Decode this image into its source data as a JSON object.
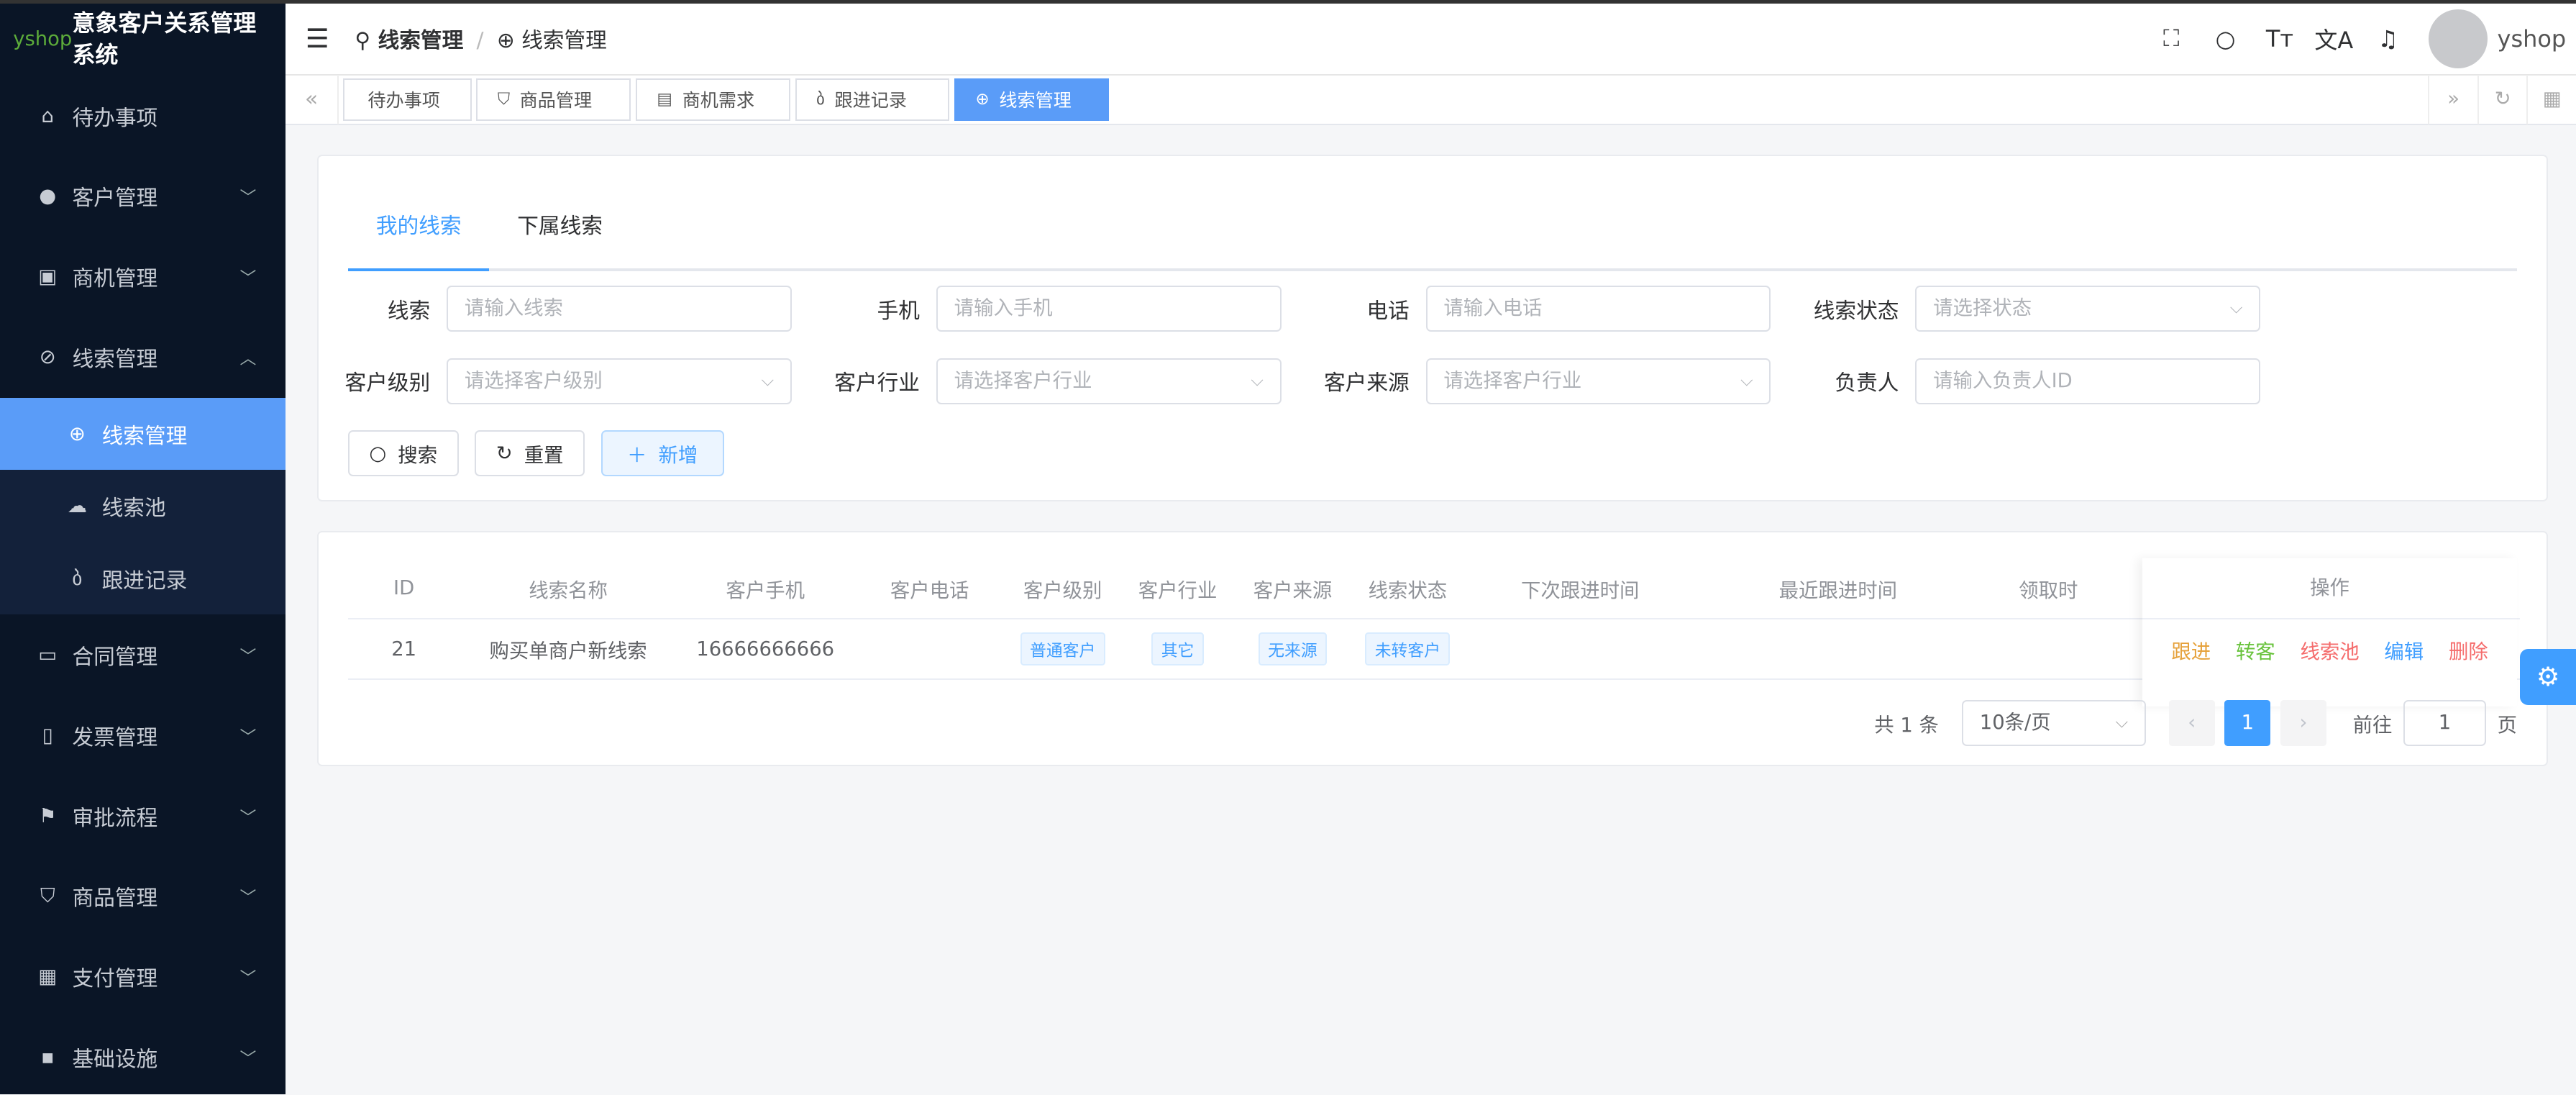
{
  "app": {
    "logo_text": "yshop",
    "title": "意象客户关系管理系统"
  },
  "sidebar": {
    "items": [
      {
        "label": "待办事项",
        "icon": "home-icon",
        "glyph": "⌂"
      },
      {
        "label": "客户管理",
        "icon": "user-icon",
        "glyph": "●"
      },
      {
        "label": "商机管理",
        "icon": "opportunity-icon",
        "glyph": "▣"
      },
      {
        "label": "线索管理",
        "icon": "link-icon",
        "glyph": "⊘"
      },
      {
        "label": "合同管理",
        "icon": "folder-icon",
        "glyph": "▭"
      },
      {
        "label": "发票管理",
        "icon": "bookmark-icon",
        "glyph": "▯"
      },
      {
        "label": "审批流程",
        "icon": "flag-icon",
        "glyph": "⚑"
      },
      {
        "label": "商品管理",
        "icon": "cart-icon",
        "glyph": "⛉"
      },
      {
        "label": "支付管理",
        "icon": "calculator-icon",
        "glyph": "▦"
      },
      {
        "label": "基础设施",
        "icon": "grid-icon",
        "glyph": "▪"
      }
    ],
    "sub_items": [
      {
        "label": "线索管理",
        "glyph": "⊕"
      },
      {
        "label": "线索池",
        "glyph": "☁"
      },
      {
        "label": "跟进记录",
        "glyph": "ბ"
      }
    ]
  },
  "header": {
    "breadcrumb": [
      "线索管理",
      "线索管理"
    ],
    "username": "yshop"
  },
  "tabs": [
    {
      "label": "待办事项",
      "glyph": ""
    },
    {
      "label": "商品管理",
      "glyph": "⛉"
    },
    {
      "label": "商机需求",
      "glyph": "▤"
    },
    {
      "label": "跟进记录",
      "glyph": "ბ"
    },
    {
      "label": "线索管理",
      "glyph": "⊕"
    }
  ],
  "search": {
    "tabs": [
      "我的线索",
      "下属线索"
    ],
    "fields": [
      {
        "label": "线索",
        "placeholder": "请输入线索"
      },
      {
        "label": "手机",
        "placeholder": "请输入手机"
      },
      {
        "label": "电话",
        "placeholder": "请输入电话"
      },
      {
        "label": "线索状态",
        "placeholder": "请选择状态"
      },
      {
        "label": "客户级别",
        "placeholder": "请选择客户级别"
      },
      {
        "label": "客户行业",
        "placeholder": "请选择客户行业"
      },
      {
        "label": "客户来源",
        "placeholder": "请选择客户行业"
      },
      {
        "label": "负责人",
        "placeholder": "请输入负责人ID"
      }
    ],
    "buttons": {
      "search": "搜索",
      "reset": "重置",
      "add": "新增"
    }
  },
  "table": {
    "columns": [
      "ID",
      "线索名称",
      "客户手机",
      "客户电话",
      "客户级别",
      "客户行业",
      "客户来源",
      "线索状态",
      "下次跟进时间",
      "最近跟进时间",
      "领取时"
    ],
    "ops_header": "操作",
    "rows": [
      {
        "id": "21",
        "name": "购买单商户新线索",
        "mobile": "16666666666",
        "phone": "",
        "level": "普通客户",
        "industry": "其它",
        "source": "无来源",
        "status": "未转客户",
        "next": "",
        "last": "",
        "claim": ""
      }
    ],
    "actions": [
      {
        "label": "跟进",
        "color": "#e6a23c"
      },
      {
        "label": "转客",
        "color": "#67c23a"
      },
      {
        "label": "线索池",
        "color": "#f56c6c"
      },
      {
        "label": "编辑",
        "color": "#409eff"
      },
      {
        "label": "删除",
        "color": "#f56c6c"
      }
    ]
  },
  "pagination": {
    "total": "共 1 条",
    "page_size": "10条/页",
    "current": "1",
    "goto_label": "前往",
    "goto_value": "1",
    "page_suffix": "页"
  }
}
